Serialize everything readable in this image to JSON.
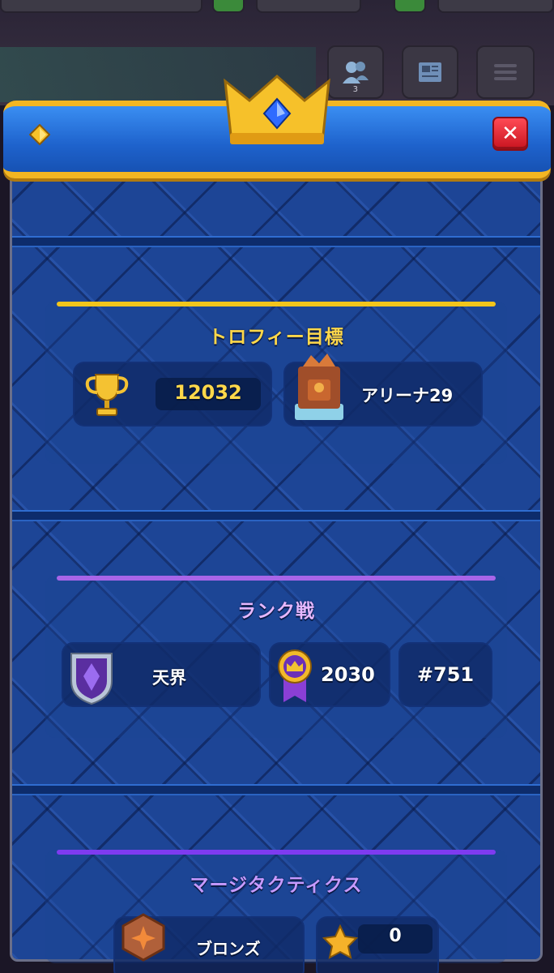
{
  "hud": {
    "friends_count": "3"
  },
  "panel": {
    "close_label": "✕"
  },
  "trophy": {
    "title": "トロフィー目標",
    "trophies": "12032",
    "arena": "アリーナ29"
  },
  "ranked": {
    "title": "ランク戦",
    "league": "天界",
    "rating": "2030",
    "rank": "#751"
  },
  "merge": {
    "title": "マージタクティクス",
    "league": "ブロンズ",
    "stars": "0"
  },
  "colors": {
    "gold": "#f3b622",
    "trophy_accent": "#f2c51b",
    "ranked_accent": "#a865e8",
    "merge_accent": "#7e3bf0",
    "title_gold": "#ffd84a",
    "title_purple": "#e6b8ff",
    "close_red": "#e2232e"
  }
}
